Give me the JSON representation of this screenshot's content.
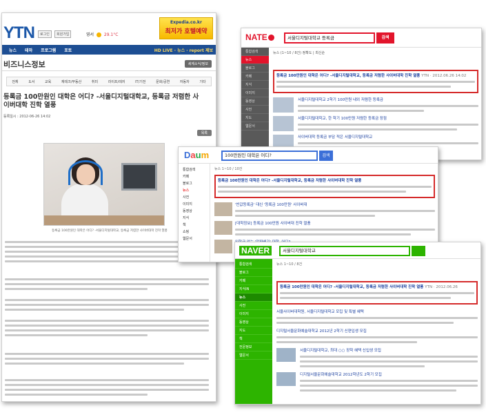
{
  "ytn": {
    "logo": "YTN",
    "login_label": "로그인",
    "join_label": "회원가입",
    "weather_label": "영서",
    "temperature": "29.1°C",
    "ad": {
      "brand": "Expedia.co.kr",
      "text": "최저가 호텔예약"
    },
    "nav": [
      "뉴스",
      "테마",
      "프로그램",
      "포토"
    ],
    "nav_right": "HD LIVE · 뉴스 · report 제보",
    "section_title": "비즈니스정보",
    "section_button": "세계소식/정보",
    "tabs": [
      "전체",
      "도서",
      "교육",
      "재테크/부동산",
      "취미",
      "라이프/레저",
      "IT/기전",
      "문화/공연",
      "자동차",
      "기타"
    ],
    "headline": "등록금 100만원인 대학은 어디? -서울디지털대학교, 등록금 저렴한 사이버대학 진학 열풍",
    "date": "등록일시 : 2012-06-26 14:02",
    "print_button": "목록",
    "caption": "등록금 100만원인 대학은 어디? -서울디지털대학교, 등록금 저렴한 사이버대학 진학 열풍"
  },
  "nate": {
    "logo": "NATE",
    "query": "서울디지털대학교 등록금",
    "search_button": "검색",
    "side": [
      "통합검색",
      "뉴스",
      "블로그",
      "카페",
      "지식",
      "이미지",
      "동영상",
      "사전",
      "지도",
      "웹문서"
    ],
    "filter": "뉴스 (1~10 / 8건)    정확도 | 최신순",
    "highlight": {
      "title": "등록금 100만원인 대학은 어디? -서울디지털대학교, 등록금 저렴한 사이버대학 진학 열풍",
      "source": "YTN · 2012.06.26 14:02"
    },
    "items": [
      "서울디지털대학교 2학기 100만원 내외 저렴한 등록금",
      "서울디지털대학교, 한 학기 100만원 저렴한 등록금 장점",
      "사이버대학 등록금 부담 적은 서울디지털대학교"
    ]
  },
  "daum": {
    "logo": "Daum",
    "query": "100만원인 대학은 어디?",
    "search_button": "검색",
    "side": [
      "통합검색",
      "카페",
      "블로그",
      "뉴스",
      "사전",
      "이미지",
      "동영상",
      "지식",
      "책",
      "쇼핑",
      "웹문서"
    ],
    "meta": "뉴스   1~10 / 10건",
    "highlight": {
      "title": "등록금 100만원인 대학은 어디? -서울디지털대학교, 등록금 저렴한 사이버대학 진학 열풍"
    },
    "items": [
      "'반값등록금' 대신 '등록금 100만원' 사이버대",
      "[대학정보] 등록금 100만원 사이버대 진학 열풍",
      "입학금 없는 '알짜배기' 대학, 어디?"
    ]
  },
  "naver": {
    "logo": "NAVER",
    "query": "서울디지털대학교",
    "side": [
      "통합검색",
      "블로그",
      "카페",
      "지식iN",
      "뉴스",
      "사전",
      "이미지",
      "동영상",
      "지도",
      "책",
      "전문정보",
      "웹문서"
    ],
    "meta": "뉴스   1~10 / 8건",
    "highlight": {
      "title": "등록금 100만원인 대학은 어디? -서울디지털대학교, 등록금 저렴한 사이버대학 진학 열풍",
      "source": "YTN · 2012.06.26"
    },
    "items": [
      "서울사이버대학원, 서울디지털대학교 모집 및 특별 혜택",
      "디지털서울문화예술대학교 2012년 2학기 신편입생 모집",
      "서울디지털대학교, 최대 ○○ 장학 혜택 신입생 모집",
      "디지털서울문화예술대학교 2012학년도 2학기 모집"
    ]
  }
}
